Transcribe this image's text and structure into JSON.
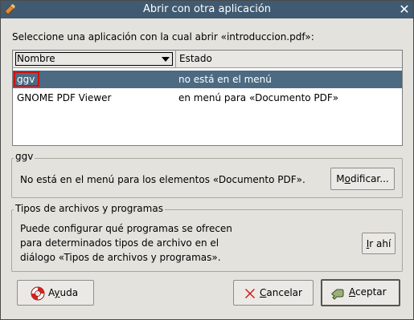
{
  "window": {
    "title": "Abrir con otra aplicación"
  },
  "prompt": "Seleccione una aplicación con la cual abrir «introduccion.pdf»:",
  "list": {
    "columns": [
      "Nombre",
      "Estado"
    ],
    "rows": [
      {
        "name": "ggv",
        "state": "no está en el menú",
        "selected": true
      },
      {
        "name": "GNOME PDF Viewer",
        "state": "en menú para «Documento PDF»",
        "selected": false
      }
    ]
  },
  "app_section": {
    "title": "ggv",
    "text": "No está en el menú para los elementos «Documento PDF».",
    "modify_label_pre": "M",
    "modify_label_u": "o",
    "modify_label_post": "dificar..."
  },
  "types_section": {
    "title": "Tipos de archivos y programas",
    "lines": [
      "Puede configurar qué programas se ofrecen",
      "para determinados tipos de archivo en el",
      "diálogo «Tipos de archivos y programas»."
    ],
    "go_label_pre": "",
    "go_label_u": "I",
    "go_label_post": "r ahí"
  },
  "buttons": {
    "help_pre": "A",
    "help_u": "y",
    "help_post": "uda",
    "cancel_pre": "",
    "cancel_u": "C",
    "cancel_post": "ancelar",
    "accept_pre": "",
    "accept_u": "A",
    "accept_post": "ceptar"
  },
  "colors": {
    "titlebar": "#3f5a71",
    "selection": "#4c6a82",
    "focus": "#d01010"
  }
}
